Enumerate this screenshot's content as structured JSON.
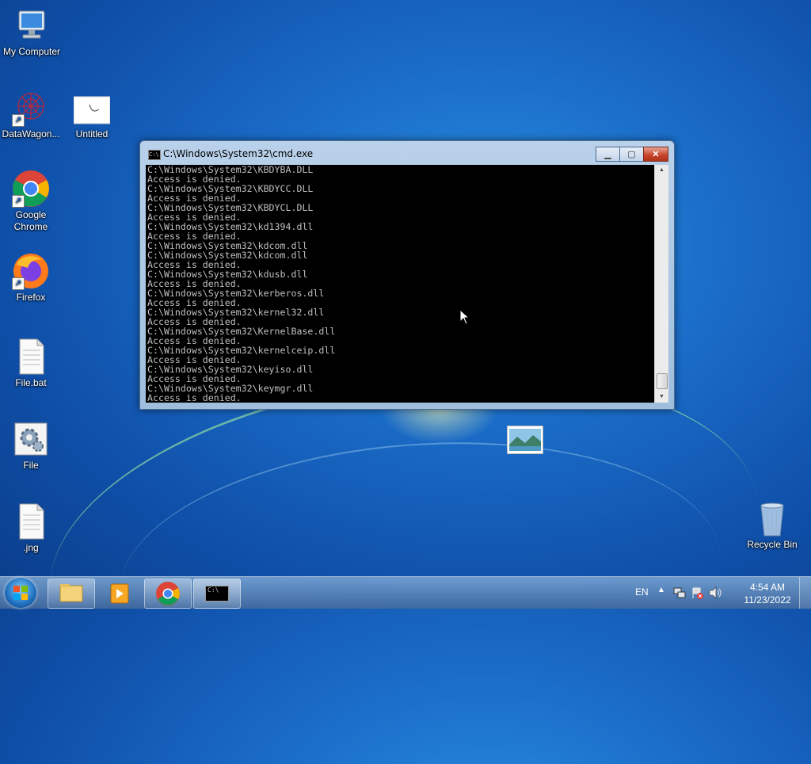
{
  "desktop": {
    "icons": {
      "my_computer": "My Computer",
      "datawagon": "DataWagon...",
      "untitled": "Untitled",
      "chrome": "Google Chrome",
      "firefox": "Firefox",
      "file_bat": "File.bat",
      "file": "File",
      "jng": ".jng",
      "recycle_bin": "Recycle Bin"
    }
  },
  "cmd_window": {
    "title": "C:\\Windows\\System32\\cmd.exe",
    "icon_text": "C:\\",
    "minimize_label": "▁",
    "maximize_label": "▢",
    "close_label": "✕",
    "lines": [
      "C:\\Windows\\System32\\KBDYBA.DLL",
      "Access is denied.",
      "C:\\Windows\\System32\\KBDYCC.DLL",
      "Access is denied.",
      "C:\\Windows\\System32\\KBDYCL.DLL",
      "Access is denied.",
      "C:\\Windows\\System32\\kd1394.dll",
      "Access is denied.",
      "C:\\Windows\\System32\\kdcom.dll",
      "C:\\Windows\\System32\\kdcom.dll",
      "Access is denied.",
      "C:\\Windows\\System32\\kdusb.dll",
      "Access is denied.",
      "C:\\Windows\\System32\\kerberos.dll",
      "Access is denied.",
      "C:\\Windows\\System32\\kernel32.dll",
      "Access is denied.",
      "C:\\Windows\\System32\\KernelBase.dll",
      "Access is denied.",
      "C:\\Windows\\System32\\kernelceip.dll",
      "Access is denied.",
      "C:\\Windows\\System32\\keyiso.dll",
      "Access is denied.",
      "C:\\Windows\\System32\\keymgr.dll",
      "Access is denied."
    ]
  },
  "taskbar": {
    "language": "EN",
    "time": "4:54 AM",
    "date": "11/23/2022",
    "cmd_icon_text": "C:\\"
  }
}
